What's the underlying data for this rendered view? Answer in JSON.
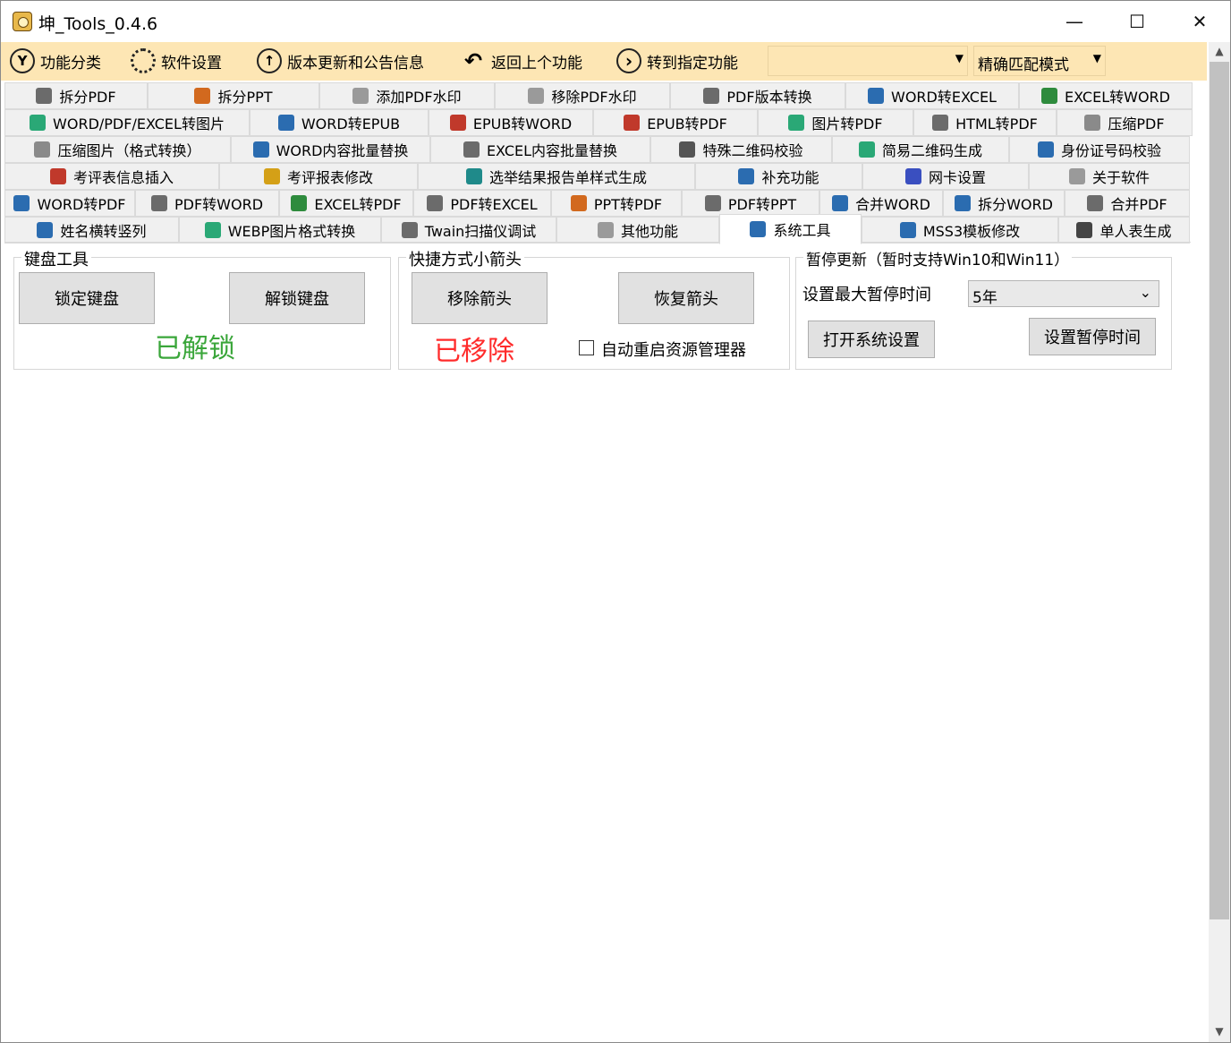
{
  "window": {
    "title": "坤_Tools_0.4.6",
    "min": "—",
    "max": "☐",
    "close": "✕"
  },
  "toolbar": {
    "items": [
      {
        "label": "功能分类",
        "icon": "y-icon",
        "glyph": "Y"
      },
      {
        "label": "软件设置",
        "icon": "gear-icon",
        "glyph": ""
      },
      {
        "label": "版本更新和公告信息",
        "icon": "arrow-up-icon",
        "glyph": "↑"
      },
      {
        "label": "返回上个功能",
        "icon": "back-arrow-icon",
        "glyph": "↶"
      },
      {
        "label": "转到指定功能",
        "icon": "chevron-right-icon",
        "glyph": "›"
      }
    ],
    "search_value": "",
    "mode_select": "精确匹配模式",
    "dropdown_arrow": "▼"
  },
  "tabs": {
    "rows": [
      [
        {
          "label": "拆分PDF",
          "color": "#6b6b6b"
        },
        {
          "label": "拆分PPT",
          "color": "#d2691e"
        },
        {
          "label": "添加PDF水印",
          "color": "#9a9a9a"
        },
        {
          "label": "移除PDF水印",
          "color": "#9a9a9a"
        },
        {
          "label": "PDF版本转换",
          "color": "#6b6b6b"
        },
        {
          "label": "WORD转EXCEL",
          "color": "#2b6cb0"
        },
        {
          "label": "EXCEL转WORD",
          "color": "#2e8b3d"
        }
      ],
      [
        {
          "label": "WORD/PDF/EXCEL转图片",
          "color": "#2aa876"
        },
        {
          "label": "WORD转EPUB",
          "color": "#2b6cb0"
        },
        {
          "label": "EPUB转WORD",
          "color": "#c0392b"
        },
        {
          "label": "EPUB转PDF",
          "color": "#c0392b"
        },
        {
          "label": "图片转PDF",
          "color": "#2aa876"
        },
        {
          "label": "HTML转PDF",
          "color": "#6b6b6b"
        },
        {
          "label": "压缩PDF",
          "color": "#8a8a8a"
        }
      ],
      [
        {
          "label": "压缩图片（格式转换）",
          "color": "#8a8a8a"
        },
        {
          "label": "WORD内容批量替换",
          "color": "#2b6cb0"
        },
        {
          "label": "EXCEL内容批量替换",
          "color": "#6b6b6b"
        },
        {
          "label": "特殊二维码校验",
          "color": "#555555"
        },
        {
          "label": "简易二维码生成",
          "color": "#2aa876"
        },
        {
          "label": "身份证号码校验",
          "color": "#2b6cb0"
        }
      ],
      [
        {
          "label": "考评表信息插入",
          "color": "#c0392b"
        },
        {
          "label": "考评报表修改",
          "color": "#d4a017"
        },
        {
          "label": "选举结果报告单样式生成",
          "color": "#1f8a8a"
        },
        {
          "label": "补充功能",
          "color": "#2b6cb0"
        },
        {
          "label": "网卡设置",
          "color": "#3a4fc0"
        },
        {
          "label": "关于软件",
          "color": "#9a9a9a"
        }
      ],
      [
        {
          "label": "WORD转PDF",
          "color": "#2b6cb0"
        },
        {
          "label": "PDF转WORD",
          "color": "#6b6b6b"
        },
        {
          "label": "EXCEL转PDF",
          "color": "#2e8b3d"
        },
        {
          "label": "PDF转EXCEL",
          "color": "#6b6b6b"
        },
        {
          "label": "PPT转PDF",
          "color": "#d2691e"
        },
        {
          "label": "PDF转PPT",
          "color": "#6b6b6b"
        },
        {
          "label": "合并WORD",
          "color": "#2b6cb0"
        },
        {
          "label": "拆分WORD",
          "color": "#2b6cb0"
        },
        {
          "label": "合并PDF",
          "color": "#6b6b6b"
        }
      ],
      [
        {
          "label": "姓名横转竖列",
          "color": "#2b6cb0"
        },
        {
          "label": "WEBP图片格式转换",
          "color": "#2aa876"
        },
        {
          "label": "Twain扫描仪调试",
          "color": "#6b6b6b"
        },
        {
          "label": "其他功能",
          "color": "#9a9a9a"
        },
        {
          "label": "系统工具",
          "color": "#2b6cb0"
        },
        {
          "label": "MSS3模板修改",
          "color": "#2b6cb0"
        },
        {
          "label": "单人表生成",
          "color": "#444444"
        }
      ]
    ]
  },
  "keyboard": {
    "title": "键盘工具",
    "lock_label": "锁定键盘",
    "unlock_label": "解锁键盘",
    "status": "已解锁",
    "status_color": "#3aa63a"
  },
  "shortcut": {
    "title": "快捷方式小箭头",
    "remove_label": "移除箭头",
    "restore_label": "恢复箭头",
    "status": "已移除",
    "status_color": "#ff2b2b",
    "restart_checkbox_label": "自动重启资源管理器",
    "restart_checked": false
  },
  "pause_update": {
    "title": "暂停更新（暂时支持Win10和Win11）",
    "max_time_label": "设置最大暂停时间",
    "max_time_value": "5年",
    "open_settings_label": "打开系统设置",
    "set_pause_label": "设置暂停时间"
  },
  "scrollbar": {
    "up": "▲",
    "down": "▼"
  }
}
